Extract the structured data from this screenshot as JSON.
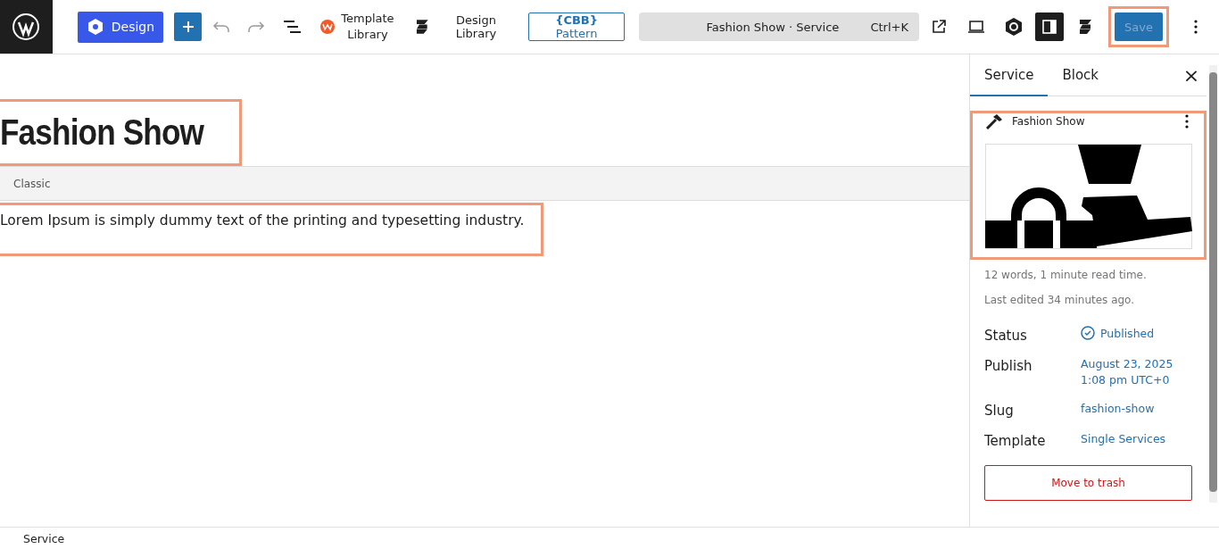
{
  "toolbar": {
    "design_button": "Design",
    "template_library": "Template\nLibrary",
    "design_library": "Design Library",
    "pattern_button": {
      "badge": "{CBB}",
      "label": "Pattern"
    },
    "command_bar": {
      "title": "Fashion Show · Service",
      "shortcut": "Ctrl+K"
    },
    "save_button": {
      "label": "Save",
      "disabled": true
    }
  },
  "editor": {
    "title": "Fashion Show",
    "classic_label": "Classic",
    "paragraph": "Lorem Ipsum is simply dummy text of the printing and typesetting industry."
  },
  "sidebar": {
    "tabs": [
      {
        "label": "Service",
        "selected": true
      },
      {
        "label": "Block",
        "selected": false
      }
    ],
    "close": "×",
    "post": {
      "title": "Fashion Show",
      "stats": "12 words, 1 minute read time.",
      "last_edited": "Last edited 34 minutes ago."
    },
    "fields": [
      {
        "label": "Status",
        "value": "Published",
        "kind": "status"
      },
      {
        "label": "Publish",
        "value": "August 23, 2025\n1:08 pm UTC+0",
        "kind": "link"
      },
      {
        "label": "Slug",
        "value": "fashion-show",
        "kind": "link"
      },
      {
        "label": "Template",
        "value": "Single Services",
        "kind": "link"
      }
    ],
    "trash_button": "Move to trash"
  },
  "status_bar": "Service"
}
